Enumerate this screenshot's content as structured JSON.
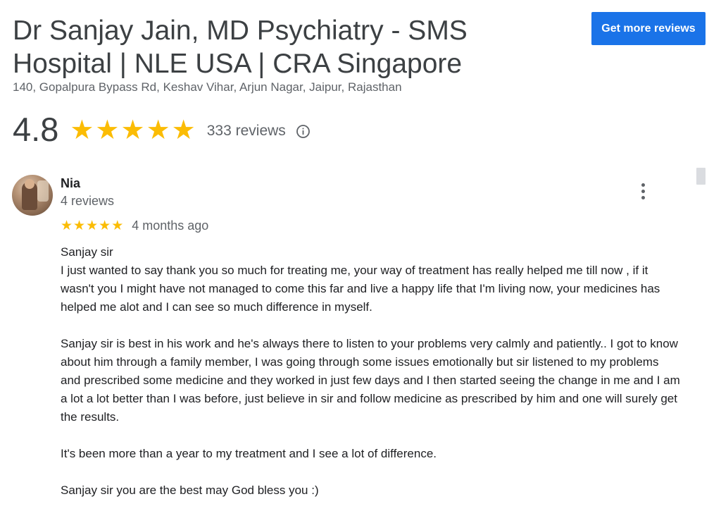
{
  "business": {
    "title": "Dr Sanjay Jain, MD Psychiatry - SMS Hospital | NLE USA | CRA Singapore",
    "address": "140, Gopalpura Bypass Rd, Keshav Vihar, Arjun Nagar, Jaipur, Rajasthan"
  },
  "cta": {
    "label": "Get more reviews"
  },
  "rating": {
    "value": "4.8",
    "stars": 5,
    "review_count": "333 reviews",
    "info_icon": "info-icon"
  },
  "review": {
    "author": "Nia",
    "author_meta": "4 reviews",
    "stars": 5,
    "date": "4 months ago",
    "more_icon": "more-vert-icon",
    "paragraphs": [
      "Sanjay sir\nI just wanted to say thank you so much for treating me, your way of treatment has really helped me till now , if it wasn't you I might have not managed to come this far and live a happy life that I'm living now, your medicines has helped me alot and I can see so much difference in myself.",
      "Sanjay sir is best in his work and he's always there to listen to your problems very calmly and patiently.. I got to know about him through a family member, I was going through some issues emotionally but sir listened to my problems and prescribed some medicine and they worked in just few days and I then started seeing the change in me and I am a lot a lot better than I was before, just believe in sir and follow medicine as prescribed by him and one will surely get the results.",
      "It's been more than a year to my treatment and I see a lot of difference.",
      "Sanjay sir you are the best may God bless you :)"
    ]
  },
  "colors": {
    "star": "#fbbc04",
    "button": "#1a73e8",
    "secondary_text": "#5f6368"
  }
}
